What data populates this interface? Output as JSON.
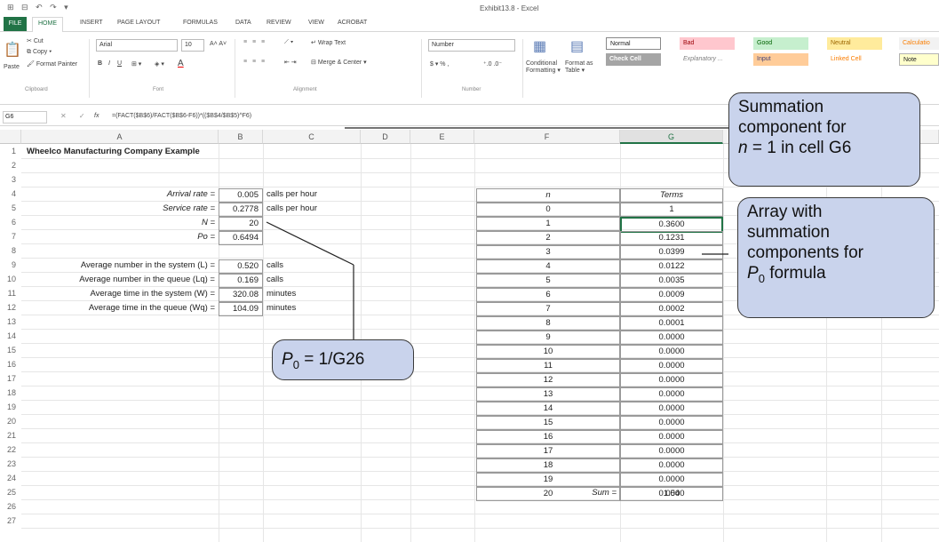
{
  "window": {
    "title": "Exhibit13.8 - Excel",
    "qat_glyphs": "⊞ ⊟ ↶ ↷ ▾"
  },
  "ribbon_tabs": [
    "FILE",
    "HOME",
    "INSERT",
    "PAGE LAYOUT",
    "FORMULAS",
    "DATA",
    "REVIEW",
    "VIEW",
    "ACROBAT"
  ],
  "ribbon": {
    "clipboard": {
      "paste": "Paste",
      "cut": "Cut",
      "copy": "Copy ▾",
      "format_painter": "Format Painter",
      "group": "Clipboard"
    },
    "font": {
      "name": "Arial",
      "size": "10",
      "bold": "B",
      "italic": "I",
      "underline": "U",
      "group": "Font"
    },
    "alignment": {
      "wrap": "Wrap Text",
      "merge": "Merge & Center ▾",
      "group": "Alignment"
    },
    "number": {
      "format": "Number",
      "currency": "$ ▾  %  ,",
      "group": "Number"
    },
    "styles": {
      "conditional": "Conditional Formatting ▾",
      "format_as_table": "Format as Table ▾",
      "normal": "Normal",
      "bad": "Bad",
      "good": "Good",
      "neutral": "Neutral",
      "calculation": "Calculatio",
      "check_cell": "Check Cell",
      "explanatory": "Explanatory ...",
      "input": "Input",
      "linked_cell": "Linked Cell",
      "note": "Note"
    }
  },
  "formula_bar": {
    "cell_ref": "G6",
    "fx": "fx",
    "formula": "=(FACT($B$6)/FACT($B$6-F6))*(($B$4/$B$5)^F6)"
  },
  "columns": [
    "A",
    "B",
    "C",
    "D",
    "E",
    "F",
    "G"
  ],
  "rows": [
    "1",
    "2",
    "3",
    "4",
    "5",
    "6",
    "7",
    "8",
    "9",
    "10",
    "11",
    "12",
    "13",
    "14",
    "15",
    "16",
    "17",
    "18",
    "19",
    "20",
    "21",
    "22",
    "23",
    "24",
    "25",
    "26",
    "27"
  ],
  "sheet": {
    "title": "Wheelco Manufacturing Company Example",
    "arrival_label": "Arrival rate =",
    "arrival_value": "0.005",
    "arrival_unit": "calls per hour",
    "service_label": "Service rate =",
    "service_value": "0.2778",
    "service_unit": "calls per hour",
    "n_label": "N =",
    "n_value": "20",
    "p0_label": "Po =",
    "p0_value": "0.6494",
    "L_label": "Average number in the system (L) =",
    "L_value": "0.520",
    "L_unit": "calls",
    "Lq_label": "Average number in the queue (Lq) =",
    "Lq_value": "0.169",
    "Lq_unit": "calls",
    "W_label": "Average time in the system (W) =",
    "W_value": "320.08",
    "W_unit": "minutes",
    "Wq_label": "Average time in the queue (Wq) =",
    "Wq_value": "104.09",
    "Wq_unit": "minutes",
    "n_header": "n",
    "terms_header": "Terms",
    "n_list": [
      "0",
      "1",
      "2",
      "3",
      "4",
      "5",
      "6",
      "7",
      "8",
      "9",
      "10",
      "11",
      "12",
      "13",
      "14",
      "15",
      "16",
      "17",
      "18",
      "19",
      "20"
    ],
    "terms": [
      "1",
      "0.3600",
      "0.1231",
      "0.0399",
      "0.0122",
      "0.0035",
      "0.0009",
      "0.0002",
      "0.0001",
      "0.0000",
      "0.0000",
      "0.0000",
      "0.0000",
      "0.0000",
      "0.0000",
      "0.0000",
      "0.0000",
      "0.0000",
      "0.0000",
      "0.0000",
      "0.0000"
    ],
    "sum_label": "Sum =",
    "sum_value": "1.54"
  },
  "callouts": {
    "summation": {
      "line1": "Summation",
      "line2": "component for",
      "line3_italic": "n",
      "line3_rest": " = 1 in cell G6"
    },
    "array": {
      "line1": "Array with",
      "line2": "summation",
      "line3": "components for",
      "line4_italic": "P",
      "line4_sub": "0",
      "line4_rest": " formula"
    },
    "p0": {
      "italic": "P",
      "sub": "0",
      "rest": " = 1/G26"
    }
  },
  "colors": {
    "excel_green": "#217346",
    "callout_fill": "#c9d3ec",
    "bad_fill": "#ffc7ce",
    "good_fill": "#c6efce",
    "neutral_fill": "#ffeb9c",
    "check_fill": "#a5a5a5"
  }
}
